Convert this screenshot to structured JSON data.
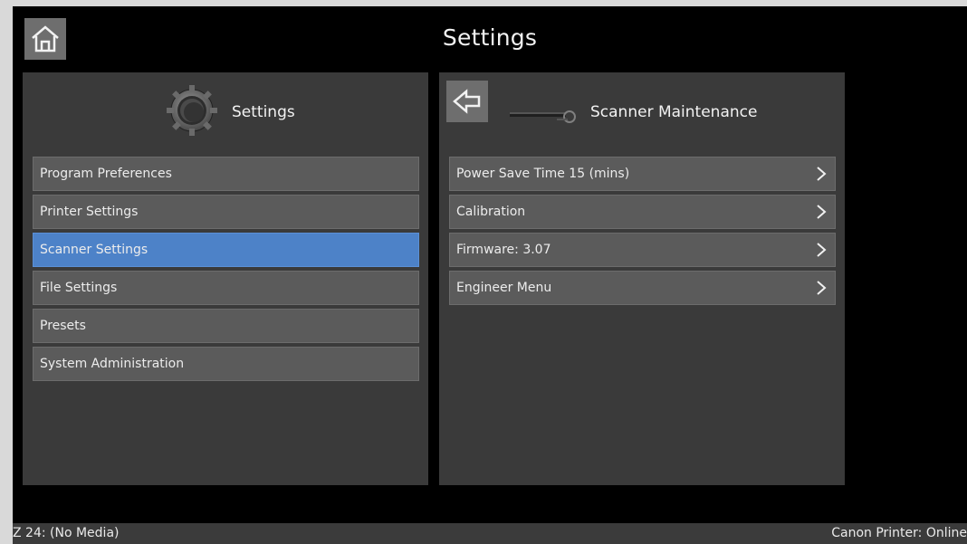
{
  "header": {
    "title": "Settings",
    "home_icon": "home-icon"
  },
  "left_panel": {
    "title": "Settings",
    "icon": "gear-icon",
    "items": [
      {
        "label": "Program Preferences",
        "selected": false
      },
      {
        "label": "Printer Settings",
        "selected": false
      },
      {
        "label": "Scanner Settings",
        "selected": true
      },
      {
        "label": "File Settings",
        "selected": false
      },
      {
        "label": "Presets",
        "selected": false
      },
      {
        "label": "System Administration",
        "selected": false
      }
    ]
  },
  "right_panel": {
    "title": "Scanner Maintenance",
    "back_icon": "back-arrow-icon",
    "icon": "scanner-maintenance-icon",
    "items": [
      {
        "label": "Power Save Time 15 (mins)"
      },
      {
        "label": "Calibration"
      },
      {
        "label": "Firmware: 3.07"
      },
      {
        "label": "Engineer Menu"
      }
    ]
  },
  "status_bar": {
    "left": "Z 24: (No Media)",
    "right": "Canon Printer: Online"
  },
  "colors": {
    "selected": "#4d82c8",
    "panel": "#3a3a3a",
    "item": "#5b5b5b",
    "background": "#000000"
  }
}
